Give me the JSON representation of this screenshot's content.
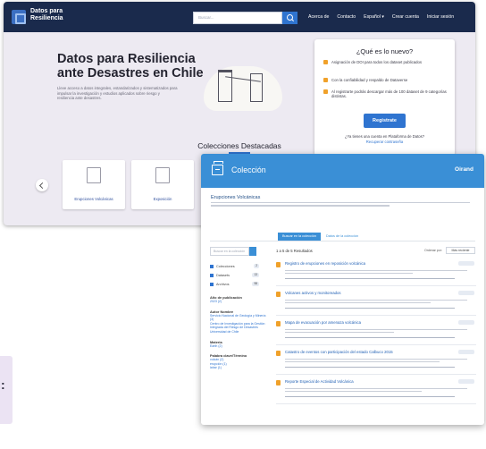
{
  "back_window": {
    "brand_line1": "Datos para",
    "brand_line2": "Resiliencia",
    "search_placeholder": "Buscar...",
    "nav_links": [
      "Acerca de",
      "Contacto",
      "Español ▾",
      "Crear cuenta",
      "Iniciar sesión"
    ],
    "hero_title_line1": "Datos para Resiliencia",
    "hero_title_line2": "ante Desastres en Chile",
    "hero_desc": "Lleve acceso a datos integrales, estandarizados y sistematizados para impulsar la investigación y estudios aplicados sobre riesgo y resiliencia ante desastres.",
    "news": {
      "title": "¿Qué es lo nuevo?",
      "items": [
        "Asignación de DOI para todos los dataset publicados",
        "Con la confiabilidad y respaldo de Dataverse",
        "Al registrarte podrás descargar más de 100 dataset de 9 categorías distintas."
      ],
      "button": "Registrate",
      "foot": "¿Ya tienes una cuenta en Plataforma de Datos?",
      "foot_link": "Recuperar contraseña"
    },
    "collections_title": "Colecciones Destacadas",
    "cards": [
      "Erupciones Volcánicas",
      "Exposición"
    ]
  },
  "front_window": {
    "title": "Colección",
    "brand": "Oirand",
    "subtitle": "Erupciones Volcánicas",
    "tab_on": "Buscar en la colección",
    "tab_off": "Datos de la colección",
    "search_placeholder": "Buscar en la colección",
    "filters": [
      {
        "label": "Colecciones",
        "count": "2"
      },
      {
        "label": "Datasets",
        "count": "13"
      },
      {
        "label": "Archivos",
        "count": "98"
      }
    ],
    "filter_sections": [
      {
        "title": "Año de publicación",
        "links": [
          "2023 (2)"
        ]
      },
      {
        "title": "Autor Nombre",
        "links": [
          "Servicio Nacional de Geología y Minería (3)",
          "Centro de Investigación para la Gestión Integrada del Riesgo de Desastres",
          "Universidad de Chile"
        ]
      },
      {
        "title": "Materia",
        "links": [
          "Earth (2)"
        ]
      },
      {
        "title": "Palabra clave/Término",
        "links": [
          "volcán (2)",
          "erupción (1)",
          "lahar (1)"
        ]
      }
    ],
    "list_heading": "1 a 5 de 5 Resultados",
    "sort_label": "Ordenar por:",
    "sort_button": "Más reciente",
    "results": [
      "Registro de erupciones en reposición volcánica",
      "Volcanes activos y monitoreados",
      "Mapa de evacuación por amenaza volcánica",
      "Catastro de eventos con participación del estado Calbuco 2015",
      "Reporte Especial de Actividad Volcánica"
    ]
  }
}
